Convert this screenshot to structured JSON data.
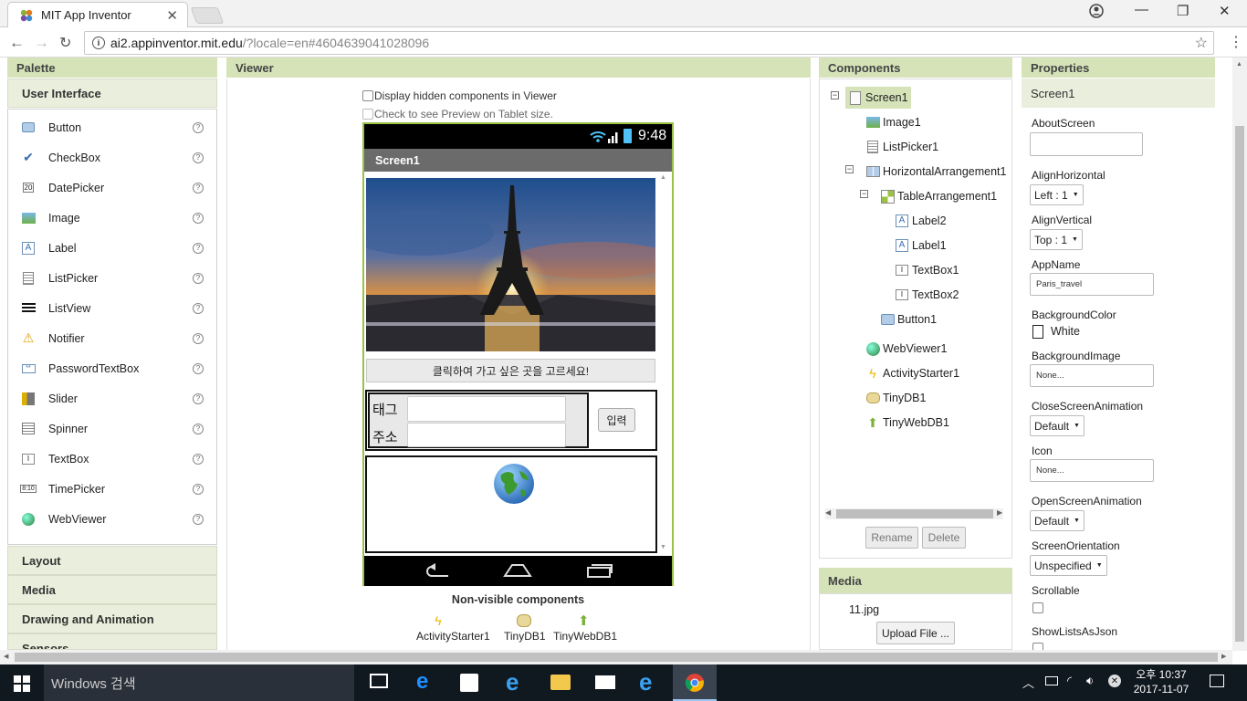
{
  "browser": {
    "tab_title": "MIT App Inventor",
    "url_host": "ai2.appinventor.mit.edu",
    "url_rest": "/?locale=en#4604639041028096"
  },
  "palette": {
    "header": "Palette",
    "open_category": "User Interface",
    "items": [
      {
        "label": "Button",
        "icon": "button-icon"
      },
      {
        "label": "CheckBox",
        "icon": "checkbox-icon"
      },
      {
        "label": "DatePicker",
        "icon": "datepicker-icon"
      },
      {
        "label": "Image",
        "icon": "image-icon"
      },
      {
        "label": "Label",
        "icon": "label-icon"
      },
      {
        "label": "ListPicker",
        "icon": "listpicker-icon"
      },
      {
        "label": "ListView",
        "icon": "listview-icon"
      },
      {
        "label": "Notifier",
        "icon": "notifier-icon"
      },
      {
        "label": "PasswordTextBox",
        "icon": "passwordtextbox-icon"
      },
      {
        "label": "Slider",
        "icon": "slider-icon"
      },
      {
        "label": "Spinner",
        "icon": "spinner-icon"
      },
      {
        "label": "TextBox",
        "icon": "textbox-icon"
      },
      {
        "label": "TimePicker",
        "icon": "timepicker-icon"
      },
      {
        "label": "WebViewer",
        "icon": "webviewer-icon"
      }
    ],
    "help_glyph": "?",
    "categories": [
      "Layout",
      "Media",
      "Drawing and Animation",
      "Sensors"
    ]
  },
  "viewer": {
    "header": "Viewer",
    "display_hidden": "Display hidden components in Viewer",
    "tablet_preview": "Check to see Preview on Tablet size.",
    "time": "9:48",
    "screen_title": "Screen1",
    "button_text": "클릭하여 가고 싶은 곳을 고르세요!",
    "tag_label": "태그",
    "address_label": "주소",
    "input_button": "입력",
    "nonvisible_title": "Non-visible components",
    "nonvisible": [
      "ActivityStarter1",
      "TinyDB1",
      "TinyWebDB1"
    ]
  },
  "components": {
    "header": "Components",
    "tree": [
      {
        "label": "Screen1",
        "icon": "screen-icon"
      },
      {
        "label": "Image1",
        "icon": "image-icon"
      },
      {
        "label": "ListPicker1",
        "icon": "listpicker-icon"
      },
      {
        "label": "HorizontalArrangement1",
        "icon": "horizontal-arrangement-icon"
      },
      {
        "label": "TableArrangement1",
        "icon": "table-arrangement-icon"
      },
      {
        "label": "Label2",
        "icon": "label-icon"
      },
      {
        "label": "Label1",
        "icon": "label-icon"
      },
      {
        "label": "TextBox1",
        "icon": "textbox-icon"
      },
      {
        "label": "TextBox2",
        "icon": "textbox-icon"
      },
      {
        "label": "Button1",
        "icon": "button-icon"
      },
      {
        "label": "WebViewer1",
        "icon": "webviewer-icon"
      },
      {
        "label": "ActivityStarter1",
        "icon": "activitystarter-icon"
      },
      {
        "label": "TinyDB1",
        "icon": "tinydb-icon"
      },
      {
        "label": "TinyWebDB1",
        "icon": "tinywebdb-icon"
      }
    ],
    "rename": "Rename",
    "delete": "Delete"
  },
  "media": {
    "header": "Media",
    "file": "11.jpg",
    "upload": "Upload File ..."
  },
  "properties": {
    "header": "Properties",
    "component": "Screen1",
    "about_label": "AboutScreen",
    "align_h_label": "AlignHorizontal",
    "align_h_value": "Left : 1",
    "align_v_label": "AlignVertical",
    "align_v_value": "Top : 1",
    "appname_label": "AppName",
    "appname_value": "Paris_travel",
    "bgcolor_label": "BackgroundColor",
    "bgcolor_value": "White",
    "bgimage_label": "BackgroundImage",
    "bgimage_value": "None...",
    "close_anim_label": "CloseScreenAnimation",
    "close_anim_value": "Default",
    "icon_label": "Icon",
    "icon_value": "None...",
    "open_anim_label": "OpenScreenAnimation",
    "open_anim_value": "Default",
    "orientation_label": "ScreenOrientation",
    "orientation_value": "Unspecified",
    "scrollable_label": "Scrollable",
    "showlists_label": "ShowListsAsJson"
  },
  "taskbar": {
    "search": "Windows 검색",
    "ampm_time": "오후 10:37",
    "date": "2017-11-07"
  },
  "colors": {
    "panel_header": "#d6e3b8",
    "phone_border": "#9bc144",
    "selected": "#d6e3b8",
    "taskbar": "#101820"
  }
}
